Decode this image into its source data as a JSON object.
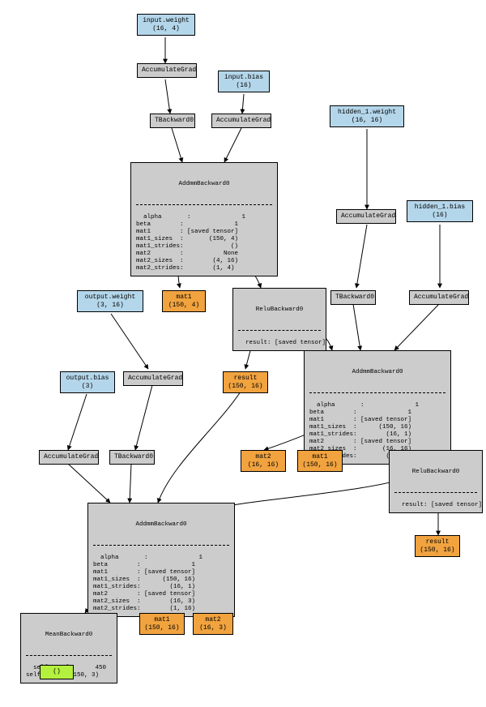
{
  "nodes": {
    "input_weight": {
      "label": "input.weight",
      "shape": "(16, 4)"
    },
    "input_bias": {
      "label": "input.bias",
      "shape": "(16)"
    },
    "hidden1_weight": {
      "label": "hidden_1.weight",
      "shape": "(16, 16)"
    },
    "hidden1_bias": {
      "label": "hidden_1.bias",
      "shape": "(16)"
    },
    "output_weight": {
      "label": "output.weight",
      "shape": "(3, 16)"
    },
    "output_bias": {
      "label": "output.bias",
      "shape": "(3)"
    },
    "accgrad1": "AccumulateGrad",
    "accgrad2": "AccumulateGrad",
    "accgrad3": "AccumulateGrad",
    "accgrad4": "AccumulateGrad",
    "accgrad5": "AccumulateGrad",
    "accgrad6": "AccumulateGrad",
    "tback0_a": "TBackward0",
    "tback0_b": "TBackward0",
    "tback0_c": "TBackward0",
    "addmm0_title": "AddmmBackward0",
    "addmm0_body": "alpha       :              1\nbeta        :              1\nmat1        : [saved tensor]\nmat1_sizes  :       (150, 4)\nmat1_strides:             ()\nmat2        :           None\nmat2_sizes  :        (4, 16)\nmat2_strides:        (1, 4)",
    "relu0_title": "ReluBackward0",
    "relu0_body": "result: [saved tensor]",
    "addmm1_title": "AddmmBackward0",
    "addmm1_body": "alpha       :              1\nbeta        :              1\nmat1        : [saved tensor]\nmat1_sizes  :      (150, 16)\nmat1_strides:        (16, 1)\nmat2        : [saved tensor]\nmat2_sizes  :       (16, 16)\nmat2_strides:        (1, 16)",
    "relu1_title": "ReluBackward0",
    "relu1_body": "result: [saved tensor]",
    "addmm2_title": "AddmmBackward0",
    "addmm2_body": "alpha       :              1\nbeta        :              1\nmat1        : [saved tensor]\nmat1_sizes  :      (150, 16)\nmat1_strides:        (16, 1)\nmat2        : [saved tensor]\nmat2_sizes  :        (16, 3)\nmat2_strides:        (1, 16)",
    "mean_title": "MeanBackward0",
    "mean_body": "self_numel:      450\nself_sizes: (150, 3)",
    "mat1_a": {
      "label": "mat1",
      "shape": "(150, 4)"
    },
    "result_a": {
      "label": "result",
      "shape": "(150, 16)"
    },
    "mat2_b": {
      "label": "mat2",
      "shape": "(16, 16)"
    },
    "mat1_b": {
      "label": "mat1",
      "shape": "(150, 16)"
    },
    "result_b": {
      "label": "result",
      "shape": "(150, 16)"
    },
    "mat1_c": {
      "label": "mat1",
      "shape": "(150, 16)"
    },
    "mat2_c": {
      "label": "mat2",
      "shape": "(16, 3)"
    },
    "output_tuple": "()"
  }
}
